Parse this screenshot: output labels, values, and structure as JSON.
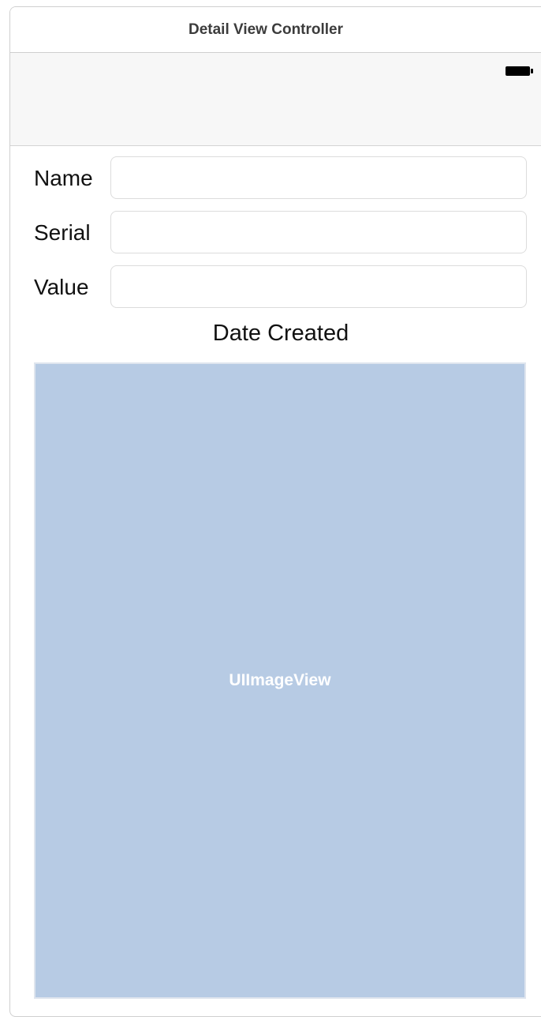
{
  "scene": {
    "title": "Detail View Controller"
  },
  "status_bar": {
    "battery_icon": "battery-icon"
  },
  "form": {
    "fields": [
      {
        "label": "Name",
        "value": "",
        "placeholder": ""
      },
      {
        "label": "Serial",
        "value": "",
        "placeholder": ""
      },
      {
        "label": "Value",
        "value": "",
        "placeholder": ""
      }
    ],
    "date_label": "Date Created"
  },
  "image_view": {
    "label": "UIImageView"
  },
  "colors": {
    "image_view_fill": "#b7cbe4",
    "nav_bar_fill": "#f7f7f7",
    "field_border": "#dcdcdc"
  }
}
